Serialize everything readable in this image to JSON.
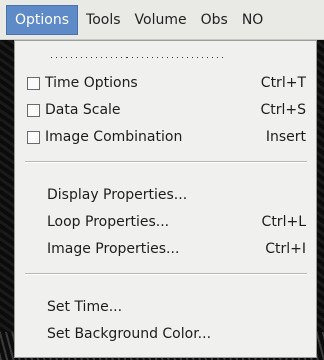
{
  "menubar": {
    "items": [
      {
        "label": "Options"
      },
      {
        "label": "Tools"
      },
      {
        "label": "Volume"
      },
      {
        "label": "Obs"
      },
      {
        "label": "NO"
      }
    ]
  },
  "menu": {
    "sections": {
      "checks": [
        {
          "label": "Time Options",
          "accel": "Ctrl+T",
          "checked": false
        },
        {
          "label": "Data Scale",
          "accel": "Ctrl+S",
          "checked": false
        },
        {
          "label": "Image Combination",
          "accel": "Insert",
          "checked": false
        }
      ],
      "properties": [
        {
          "label": "Display Properties...",
          "accel": ""
        },
        {
          "label": "Loop Properties...",
          "accel": "Ctrl+L"
        },
        {
          "label": "Image Properties...",
          "accel": "Ctrl+I"
        }
      ],
      "time": [
        {
          "label": "Set Time...",
          "accel": ""
        },
        {
          "label": "Set Background Color...",
          "accel": ""
        }
      ]
    }
  }
}
